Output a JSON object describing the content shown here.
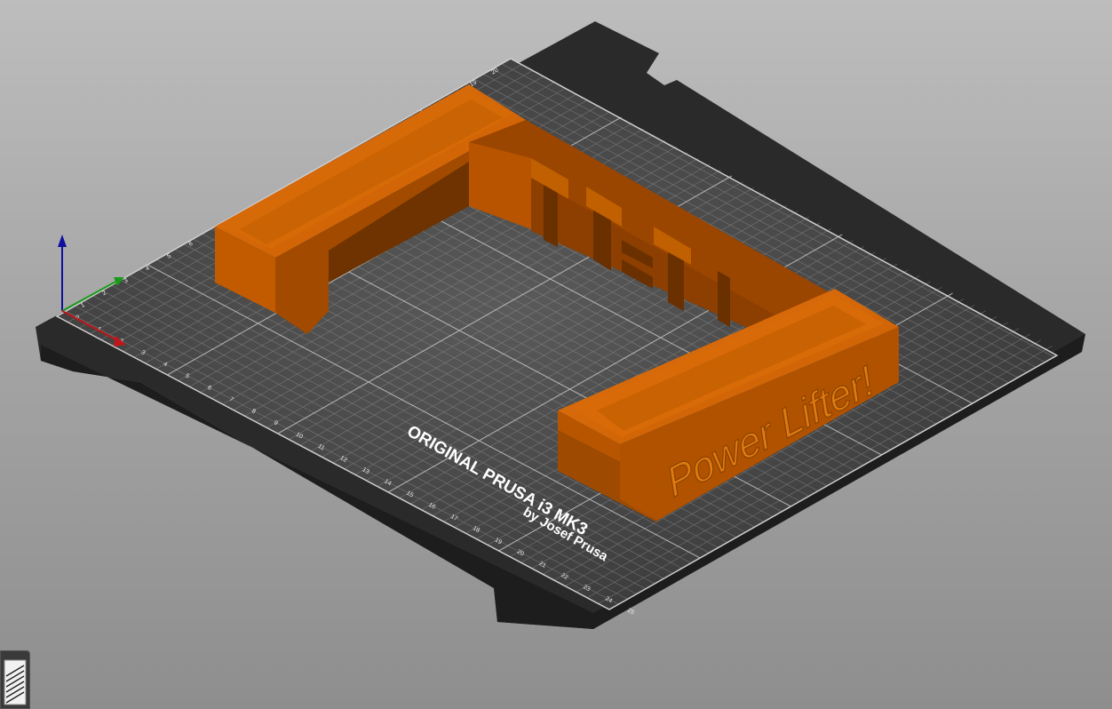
{
  "bed": {
    "brand_line1": "ORIGINAL PRUSA i3 MK3",
    "brand_line2": "by Josef Prusa",
    "x_ticks": [
      "0",
      "1",
      "2",
      "3",
      "4",
      "5",
      "6",
      "7",
      "8",
      "9",
      "10",
      "11",
      "12",
      "13",
      "14",
      "15",
      "16",
      "17",
      "18",
      "19",
      "20",
      "21",
      "22",
      "23",
      "24",
      "25"
    ],
    "y_ticks": [
      "1",
      "2",
      "3",
      "4",
      "5",
      "6",
      "19",
      "20"
    ]
  },
  "model": {
    "embossed_text": "Power Lifter!"
  },
  "colors": {
    "model": "#d06000",
    "model_dark": "#a04a00",
    "model_shade": "#7a3800",
    "bed_sheet": "#3d3d3d",
    "bed_frame": "#2b2b2b",
    "axis_x": "#c0161a",
    "axis_y": "#1a9a1a",
    "axis_z": "#1a1ab0"
  },
  "icons": {
    "layers": "layers-icon",
    "axes": "axes-gizmo-icon"
  }
}
